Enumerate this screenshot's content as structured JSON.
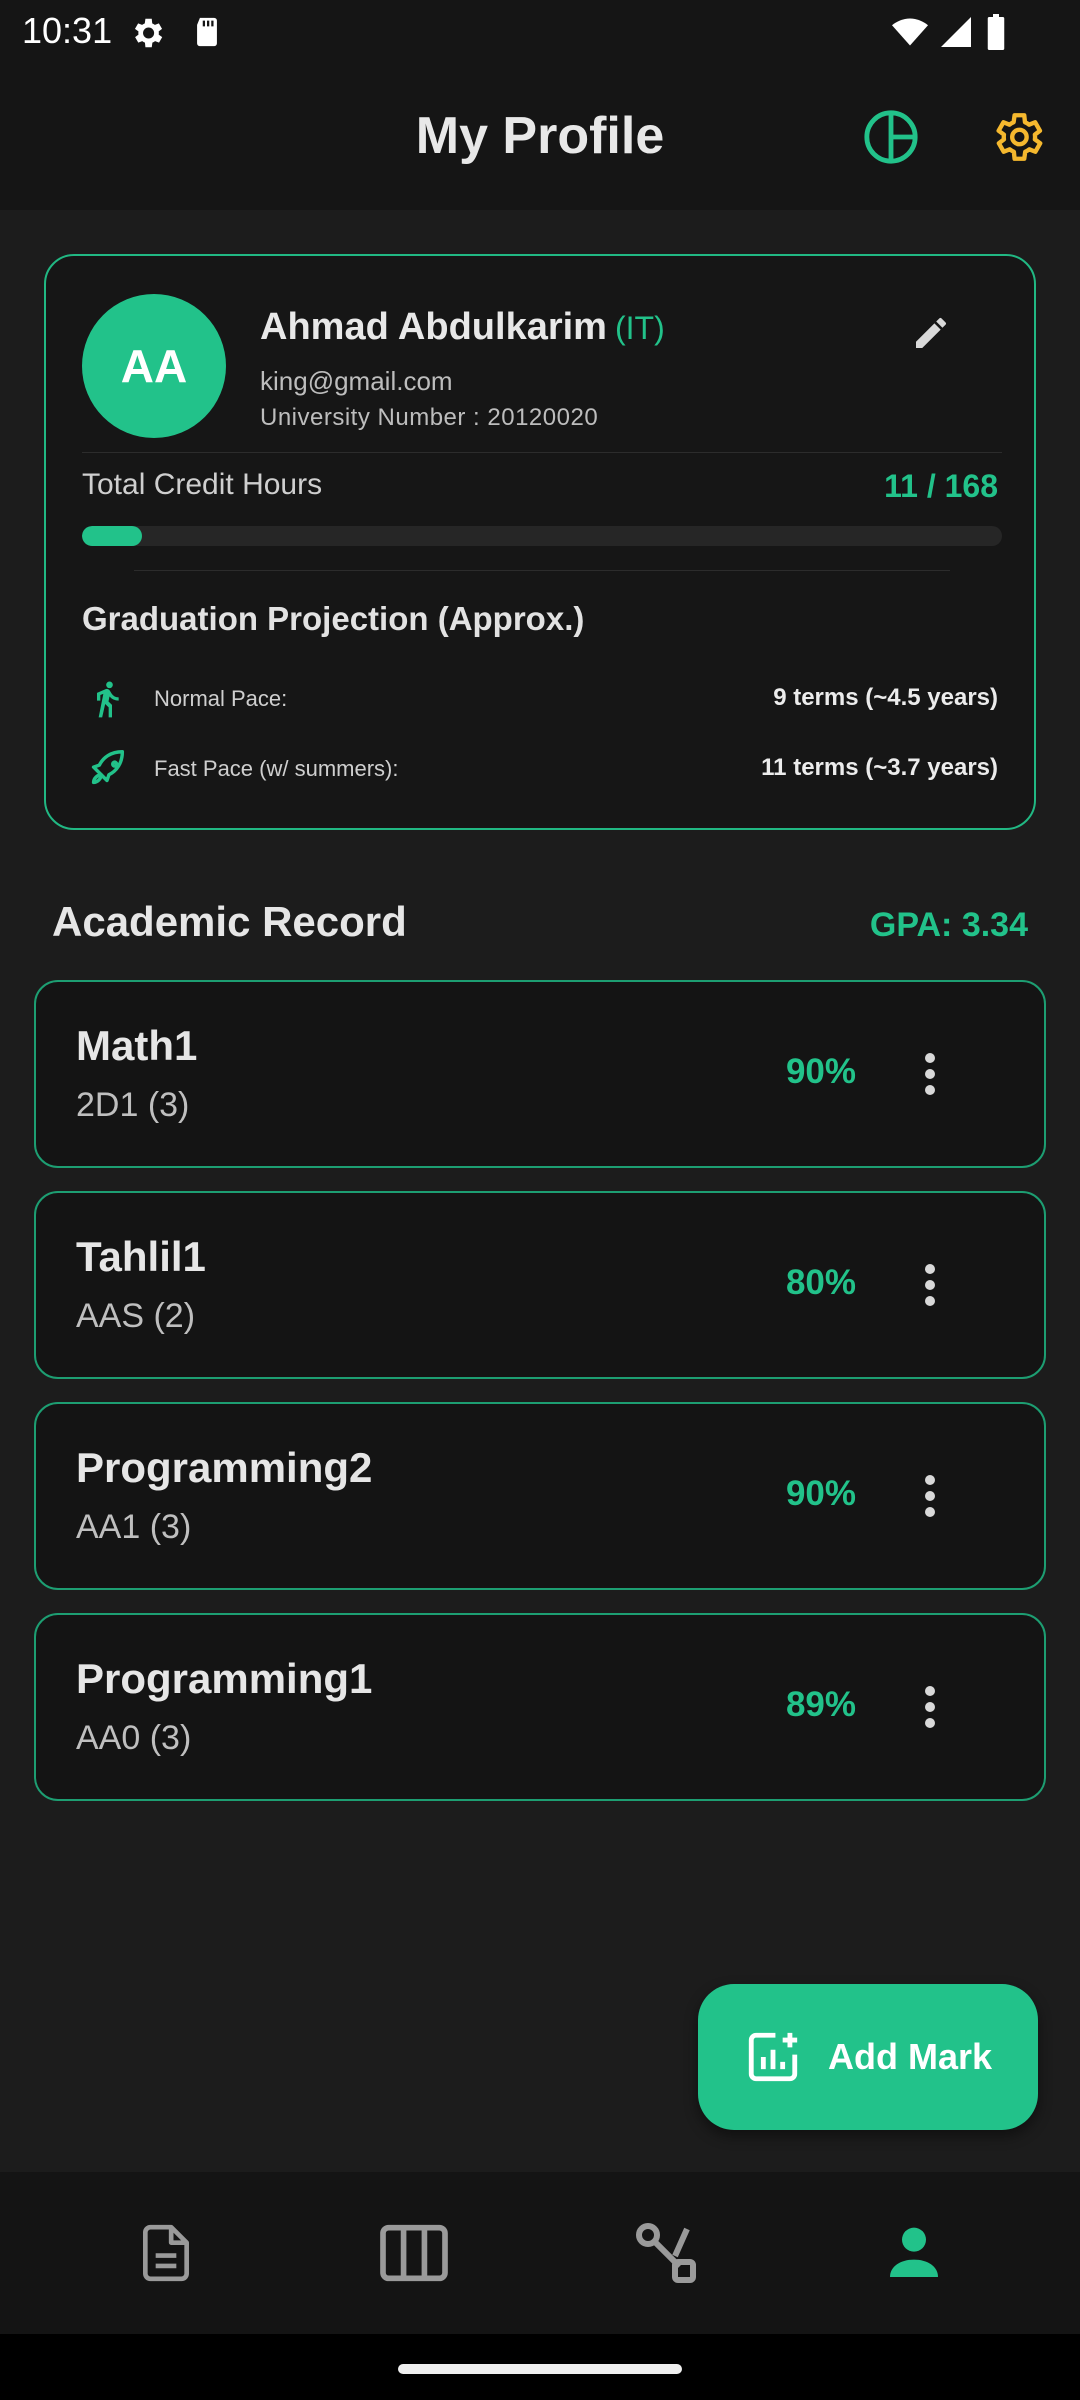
{
  "status_bar": {
    "time": "10:31",
    "icons": [
      "settings-status-icon",
      "sd-card-icon",
      "wifi-icon",
      "signal-icon",
      "battery-icon"
    ]
  },
  "header": {
    "title": "My Profile",
    "actions": [
      "pie-chart-icon",
      "gear-icon"
    ],
    "accent_color": "#22c28a",
    "settings_color": "#f5b82e"
  },
  "profile": {
    "initials": "AA",
    "name": "Ahmad Abdulkarim",
    "department": "(IT)",
    "email": "king@gmail.com",
    "university_number": "University Number : 20120020",
    "credit_label": "Total Credit Hours",
    "credit_value": "11 / 168",
    "credit_progress": 0.065,
    "projection_title": "Graduation Projection (Approx.)",
    "paces": [
      {
        "icon": "walking-icon",
        "label": "Normal Pace:",
        "value": "9 terms (~4.5 years)"
      },
      {
        "icon": "rocket-icon",
        "label": "Fast Pace (w/ summers):",
        "value": "11 terms (~3.7 years)"
      }
    ]
  },
  "academic": {
    "title": "Academic Record",
    "gpa": "GPA: 3.34",
    "courses": [
      {
        "name": "Math1",
        "sub": "2D1 (3)",
        "percent": "90%"
      },
      {
        "name": "Tahlil1",
        "sub": "AAS (2)",
        "percent": "80%"
      },
      {
        "name": "Programming2",
        "sub": "AA1 (3)",
        "percent": "90%"
      },
      {
        "name": "Programming1",
        "sub": "AA0 (3)",
        "percent": "89%"
      }
    ]
  },
  "fab": {
    "label": "Add Mark",
    "icon": "add-chart-icon"
  },
  "bottom_nav": {
    "items": [
      "document-icon",
      "columns-icon",
      "route-icon",
      "person-icon"
    ],
    "active": 3
  }
}
